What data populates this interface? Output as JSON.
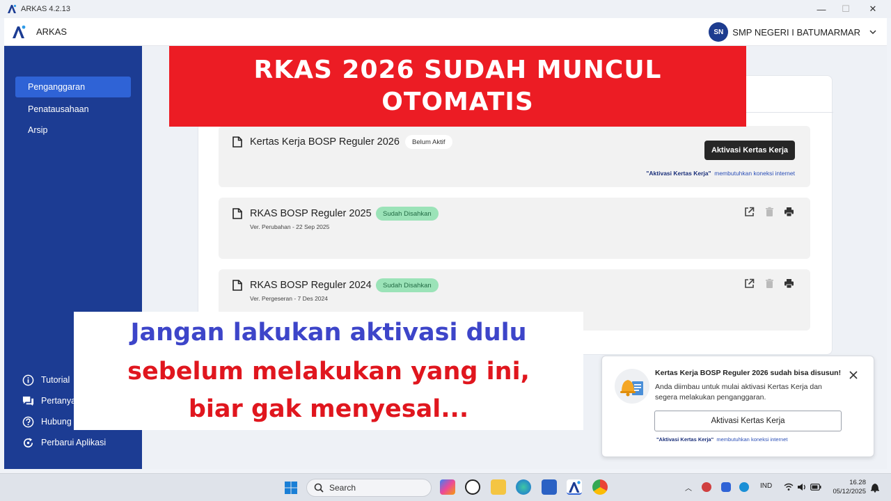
{
  "window": {
    "title": "ARKAS  4.2.13",
    "minimize": "—",
    "maximize": "☐",
    "close": "✕"
  },
  "header": {
    "app_name": "ARKAS",
    "avatar_initials": "SN",
    "school_name": "SMP NEGERI I BATUMARMAR"
  },
  "sidebar": {
    "items": [
      {
        "label": "Penganggaran",
        "active": true
      },
      {
        "label": "Penatausahaan",
        "active": false
      },
      {
        "label": "Arsip",
        "active": false
      }
    ],
    "bottom_items": [
      {
        "label": "Tutorial",
        "icon": "info-icon"
      },
      {
        "label": "Pertanya",
        "icon": "chat-icon"
      },
      {
        "label": "Hubung",
        "icon": "help-icon"
      },
      {
        "label": "Perbarui Aplikasi",
        "icon": "refresh-icon"
      }
    ]
  },
  "documents": [
    {
      "title": "Kertas Kerja BOSP Reguler 2026",
      "badge": "Belum Aktif",
      "button": "Aktivasi Kertas Kerja",
      "note_bold": "\"Aktivasi Kertas Kerja\"",
      "note": "membutuhkan koneksi internet"
    },
    {
      "title": "RKAS BOSP Reguler 2025",
      "badge": "Sudah Disahkan",
      "subtitle": "Ver. Perubahan - 22 Sep 2025"
    },
    {
      "title": "RKAS BOSP Reguler 2024",
      "badge": "Sudah Disahkan",
      "subtitle": "Ver. Pergeseran - 7 Des 2024"
    }
  ],
  "overlay_top": {
    "line1": "RKAS 2026 SUDAH MUNCUL",
    "line2": "OTOMATIS"
  },
  "overlay_bottom": {
    "line1": "Jangan lakukan aktivasi dulu",
    "line2": "sebelum melakukan yang ini,",
    "line3": "biar gak menyesal..."
  },
  "toast": {
    "title": "Kertas Kerja BOSP Reguler 2026 sudah bisa disusun!",
    "body": "Anda diimbau untuk mulai aktivasi Kertas Kerja dan segera melakukan penganggaran.",
    "button": "Aktivasi Kertas Kerja",
    "note_bold": "\"Aktivasi Kertas Kerja\"",
    "note": "membutuhkan koneksi internet"
  },
  "taskbar": {
    "search_placeholder": "Search",
    "language": "IND",
    "time": "16.28",
    "date": "05/12/2025"
  },
  "colors": {
    "sidebar": "#1c3c93",
    "active_nav": "#2f63d6",
    "red_banner": "#ec1c24",
    "badge_green": "#9be3b8"
  }
}
